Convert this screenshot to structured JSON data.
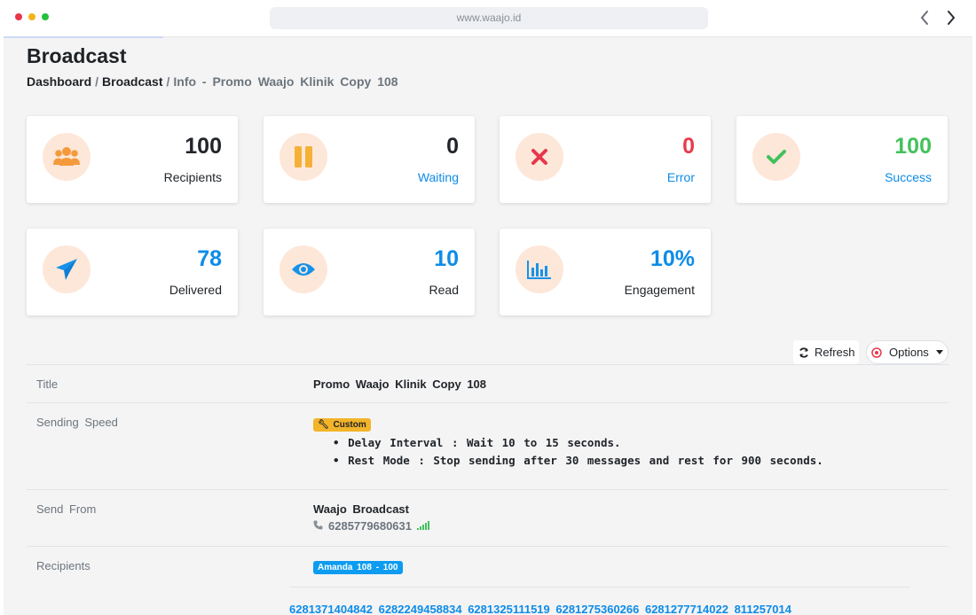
{
  "browser": {
    "url": "www.waajo.id"
  },
  "page": {
    "title": "Broadcast",
    "breadcrumb": {
      "dashboard": "Dashboard",
      "broadcast": "Broadcast",
      "current": "Info - Promo Waajo Klinik Copy 108"
    }
  },
  "stats": [
    {
      "value": "100",
      "label": "Recipients",
      "icon": "users-icon",
      "value_color": "#212529",
      "label_color": "#212529"
    },
    {
      "value": "0",
      "label": "Waiting",
      "icon": "pause-icon",
      "value_color": "#212529",
      "label_color": "#0d8ce8"
    },
    {
      "value": "0",
      "label": "Error",
      "icon": "x-icon",
      "value_color": "#ea3a4c",
      "label_color": "#0d8ce8"
    },
    {
      "value": "100",
      "label": "Success",
      "icon": "check-icon",
      "value_color": "#43c15c",
      "label_color": "#0d8ce8"
    },
    {
      "value": "78",
      "label": "Delivered",
      "icon": "paper-plane-icon",
      "value_color": "#0d8ce8",
      "label_color": "#212529"
    },
    {
      "value": "10",
      "label": "Read",
      "icon": "eye-icon",
      "value_color": "#0d8ce8",
      "label_color": "#212529"
    },
    {
      "value": "10%",
      "label": "Engagement",
      "icon": "bar-chart-icon",
      "value_color": "#0d8ce8",
      "label_color": "#212529"
    }
  ],
  "toolbar": {
    "refresh_label": "Refresh",
    "options_label": "Options"
  },
  "details": {
    "title_label": "Title",
    "title_value": "Promo Waajo Klinik Copy 108",
    "speed_label": "Sending Speed",
    "speed_badge": "Custom",
    "delay_text": "Delay Interval : Wait 10 to 15 seconds.",
    "rest_text": "Rest Mode : Stop sending after 30 messages and rest for 900 seconds.",
    "from_label": "Send From",
    "from_name": "Waajo Broadcast",
    "from_phone": "6285779680631",
    "recipients_label": "Recipients",
    "recipients_badge": "Amanda 108 - 100",
    "recipient_numbers": "6281371404842 6282249458834 6281325111519 6281275360266 6281277714022 811257014"
  },
  "colors": {
    "accent_blue": "#0d8ce8",
    "icon_orange": "#f59a3c",
    "icon_bg": "#fde7d9"
  }
}
